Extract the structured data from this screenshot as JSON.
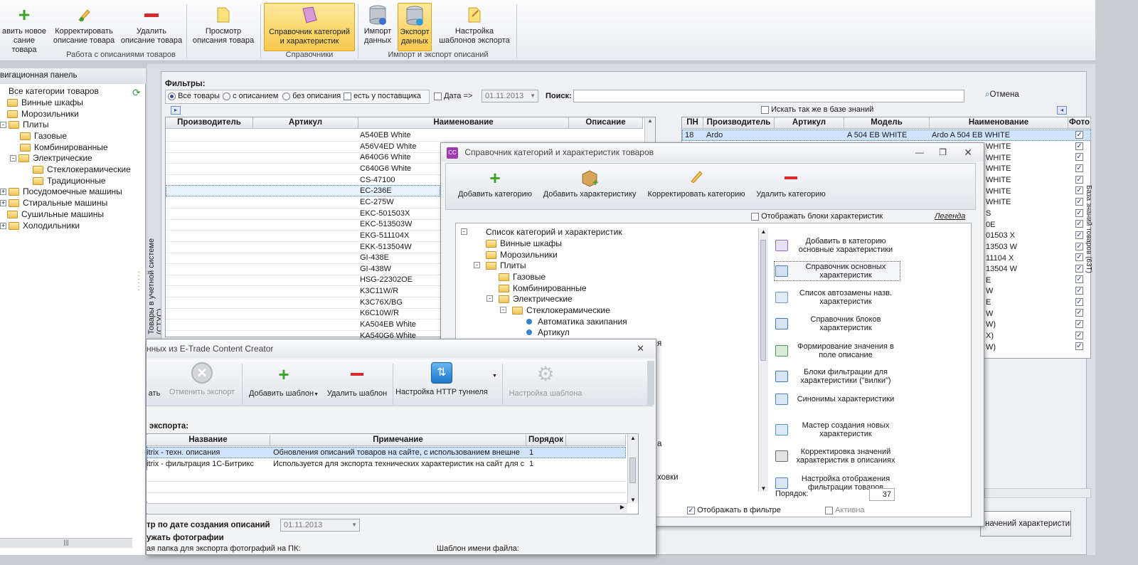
{
  "ribbon": {
    "buttons": [
      {
        "label1": "авить новое",
        "label2": "сание товара",
        "icon": "plus-icon"
      },
      {
        "label1": "Корректировать",
        "label2": "описание товара",
        "icon": "pencil-icon"
      },
      {
        "label1": "Удалить",
        "label2": "описание товара",
        "icon": "minus-icon"
      },
      {
        "label1": "Просмотр",
        "label2": "описания товара",
        "icon": "document-icon"
      },
      {
        "label1": "Справочник категорий",
        "label2": "и характеристик",
        "icon": "book-icon"
      },
      {
        "label1": "Импорт",
        "label2": "данных",
        "icon": "database-import-icon"
      },
      {
        "label1": "Экспорт",
        "label2": "данных",
        "icon": "database-export-icon"
      },
      {
        "label1": "Настройка",
        "label2": "шаблонов экспорта",
        "icon": "template-icon"
      }
    ],
    "groups": [
      "Работа с описаниями товаров",
      "Справочники",
      "Импорт и экспорт описаний"
    ]
  },
  "nav": {
    "title": "вигационная панель",
    "items": [
      "Все категории товаров",
      "Винные шкафы",
      "Морозильники",
      "Плиты",
      "Газовые",
      "Комбинированные",
      "Электрические",
      "Стеклокерамические",
      "Традиционные",
      "Посудомоечные машины",
      "Стиральные машины",
      "Сушильные машины",
      "Холодильники"
    ]
  },
  "main": {
    "vtab": "Товары в учетной системе (СТУС)",
    "filters_label": "Фильтры:",
    "radios": [
      "Все товары",
      "с описанием",
      "без описания"
    ],
    "supplier": "есть у поставщика",
    "date_label": "Дата =>",
    "date_value": "01.11.2013",
    "search_label": "Поиск:",
    "cancel": "Отмена",
    "kb_search": "Искать так же в базе знаний",
    "left_cols": [
      "Производитель",
      "Артикул",
      "Наименование",
      "Описание"
    ],
    "left_rows": [
      "A540EB White",
      "A56V4ED White",
      "A640G6 White",
      "C640G6 White",
      "CS-47100",
      "EC-236E",
      "EC-275W",
      "EKC-501503X",
      "EKC-513503W",
      "EKG-511104X",
      "EKK-513504W",
      "GI-438E",
      "GI-438W",
      "HSG-22302OE",
      "K3C11W/R",
      "K3C76X/BG",
      "K6C10W/R",
      "KA504EB White",
      "KA540G6 White"
    ],
    "right_cols": [
      "ПН",
      "Производитель",
      "Артикул",
      "Модель",
      "Наименование",
      "Фото"
    ],
    "right_first": {
      "pn": "18",
      "maker": "Ardo",
      "model": "A 504 EB WHITE",
      "name": "Ardo A 504 EB WHITE"
    },
    "right_rows": [
      "WHITE",
      "WHITE",
      "WHITE",
      "WHITE",
      "WHITE",
      "WHITE",
      "S",
      "0E",
      "01503 X",
      "13503 W",
      "11104 X",
      "13504 W",
      "E",
      "W",
      "E",
      "W",
      "W)",
      "X)",
      "W)"
    ],
    "right_vtab": "База знаний товаров (63Т)",
    "bottom_btn": "начений характеристик"
  },
  "cat_dialog": {
    "title": "Справочник категорий и характеристик товаров",
    "app_icon": "CC",
    "toolbar": [
      "Добавить категорию",
      "Добавить характеристику",
      "Корректировать категорию",
      "Удалить категорию"
    ],
    "show_blocks": "Отображать блоки характеристик",
    "legend": "Легенда",
    "tree": [
      "Список категорий и характеристик",
      "Винные шкафы",
      "Морозильники",
      "Плиты",
      "Газовые",
      "Комбинированные",
      "Электрические",
      "Стеклокерамические",
      "Автоматика закипания",
      "Артикул"
    ],
    "actions": [
      [
        "Добавить в категорию",
        "основные характеристики"
      ],
      [
        "Справочник основных",
        "характеристик"
      ],
      [
        "Список автозамены назв.",
        "характеристик"
      ],
      [
        "Справочник блоков",
        "характеристик"
      ],
      [
        "Формирование значения в",
        "поле описание"
      ],
      [
        "Блоки фильтрации для",
        "характеристики (\"вилки\")"
      ],
      [
        "Синонимы характеристики",
        ""
      ],
      [
        "Мастер создания новых",
        "характеристик"
      ],
      [
        "Корректировка значений",
        "характеристик в описаниях"
      ],
      [
        "Настройка отображения",
        "фильтрации товаров"
      ]
    ],
    "order_label": "Порядок:",
    "order_value": "37",
    "show_in_filter": "Отображать в фильтре",
    "active": "Активна",
    "behind_text": [
      "я",
      "ховки",
      "а"
    ]
  },
  "export_dialog": {
    "title": "нных из E-Trade Content Creator",
    "toolbar": [
      "ать",
      "Отменить экспорт",
      "Добавить шаблон",
      "Удалить шаблон",
      "Настройка HTTP туннеля",
      "Настройка шаблона"
    ],
    "section": "экспорта:",
    "cols": [
      "Название",
      "Примечание",
      "Порядок"
    ],
    "rows": [
      {
        "name": "itrix - техн. описания",
        "note": "Обновления описаний товаров на сайте, с использованием внешне",
        "order": "1"
      },
      {
        "name": "itrix - фильтрация 1С-Битрикс",
        "note": "Используется для экспорта технических характеристик на сайт для с",
        "order": "1"
      }
    ],
    "date_filter": "тр по дате создания описаний",
    "date_value": "01.11.2013",
    "photos": "ужать фотографии",
    "photo_folder": "ая папка для экспорта фотографий на ПК:",
    "file_template": "Шаблон имени файла:"
  }
}
